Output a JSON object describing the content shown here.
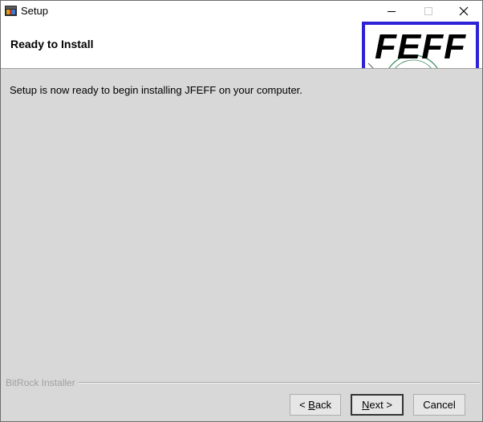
{
  "window": {
    "title": "Setup",
    "controls": {
      "minimize": "minimize-icon",
      "maximize": "maximize-icon",
      "close": "close-icon"
    }
  },
  "header": {
    "title": "Ready to Install",
    "logo_text": "FEFF"
  },
  "content": {
    "message": "Setup is now ready to begin installing JFEFF on your computer."
  },
  "footer": {
    "brand": "BitRock Installer",
    "back": {
      "prefix": "< ",
      "mnemonic": "B",
      "rest": "ack"
    },
    "next": {
      "mnemonic": "N",
      "rest": "ext >"
    },
    "cancel": "Cancel"
  },
  "colors": {
    "logo_border": "#2d22d6",
    "content_bg": "#d8d8d8"
  }
}
